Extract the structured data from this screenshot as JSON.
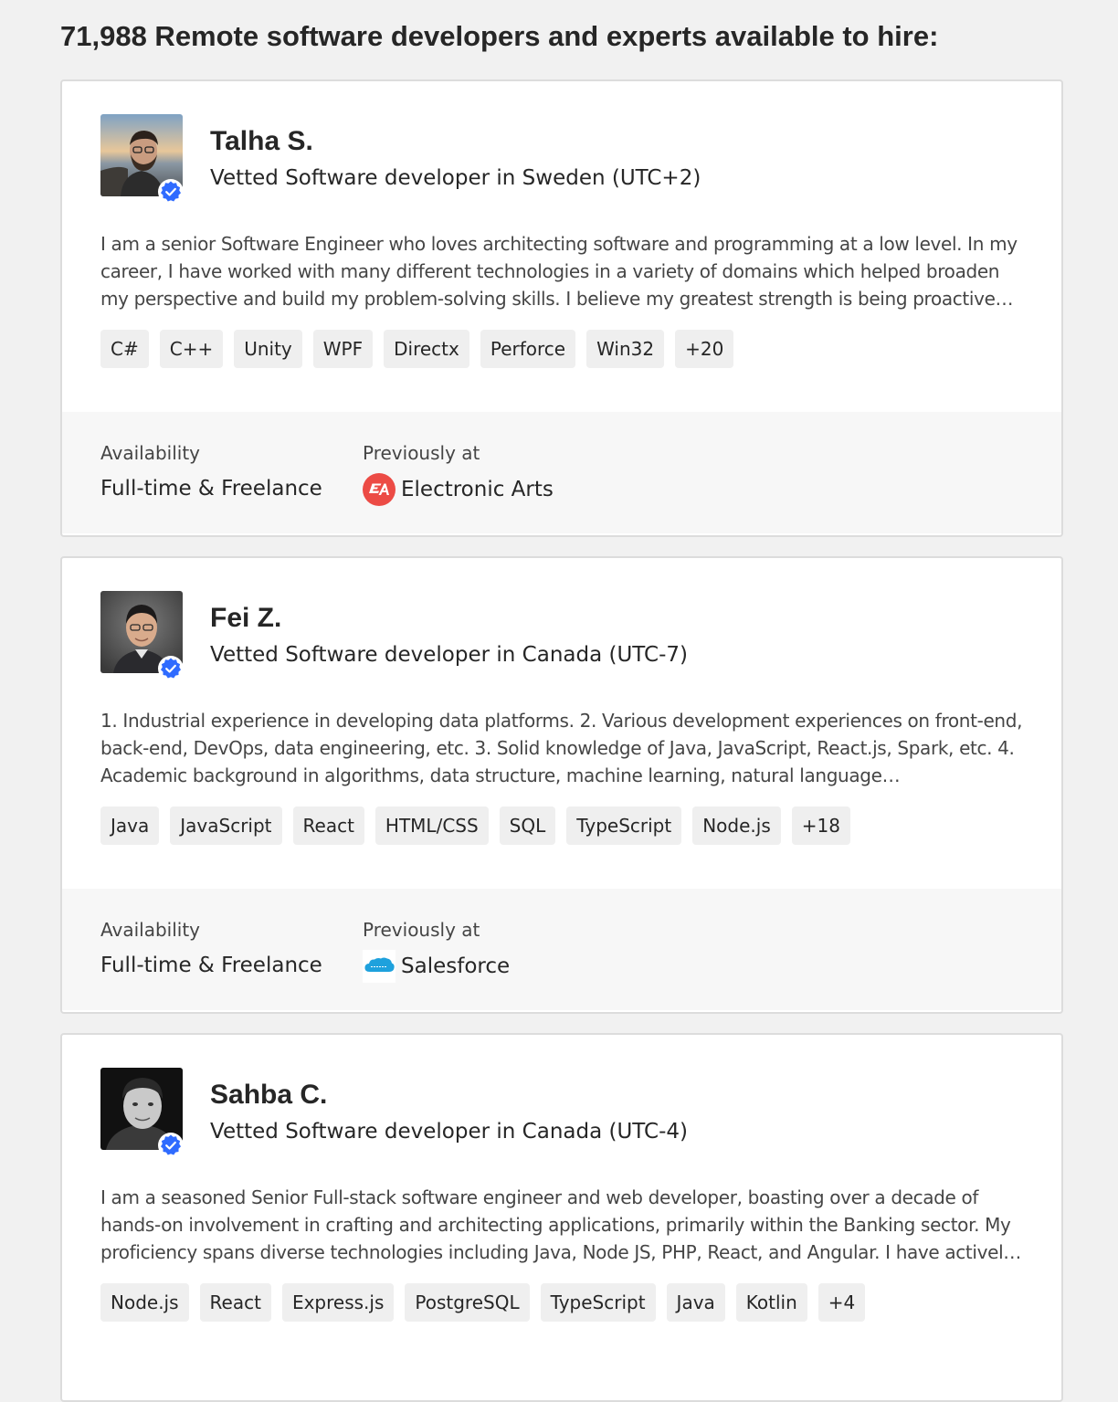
{
  "page_title": "71,988 Remote software developers and experts available to hire:",
  "labels": {
    "availability": "Availability",
    "previously_at": "Previously at"
  },
  "colors": {
    "verified_badge": "#2f6bff",
    "ea_logo": "#ec4b45",
    "salesforce_logo": "#1ea1dd"
  },
  "developers": [
    {
      "name": "Talha S.",
      "role": "Vetted Software developer in Sweden (UTC+2)",
      "bio": "I am a senior Software Engineer who loves architecting software and programming at a low level. In my career, I have worked with many different technologies in a variety of domains which helped broaden my perspective and build my problem-solving skills. I believe my greatest strength is being proactive…",
      "skills": [
        "C#",
        "C++",
        "Unity",
        "WPF",
        "Directx",
        "Perforce",
        "Win32",
        "+20"
      ],
      "availability": "Full-time & Freelance",
      "previous_company": "Electronic Arts",
      "company_logo_icon": "ea-logo-icon"
    },
    {
      "name": "Fei Z.",
      "role": "Vetted Software developer in Canada (UTC-7)",
      "bio": "1. Industrial experience in developing data platforms. 2. Various development experiences on front-end, back-end, DevOps, data engineering, etc. 3. Solid knowledge of Java, JavaScript, React.js, Spark, etc. 4. Academic background in algorithms, data structure, machine learning, natural language…",
      "skills": [
        "Java",
        "JavaScript",
        "React",
        "HTML/CSS",
        "SQL",
        "TypeScript",
        "Node.js",
        "+18"
      ],
      "availability": "Full-time & Freelance",
      "previous_company": "Salesforce",
      "company_logo_icon": "salesforce-logo-icon"
    },
    {
      "name": "Sahba C.",
      "role": "Vetted Software developer in Canada (UTC-4)",
      "bio": "I am a seasoned Senior Full-stack software engineer and web developer, boasting over a decade of hands-on involvement in crafting and architecting applications, primarily within the Banking sector. My proficiency spans diverse technologies including Java, Node JS, PHP, React, and Angular. I have activel…",
      "skills": [
        "Node.js",
        "React",
        "Express.js",
        "PostgreSQL",
        "TypeScript",
        "Java",
        "Kotlin",
        "+4"
      ]
    }
  ]
}
